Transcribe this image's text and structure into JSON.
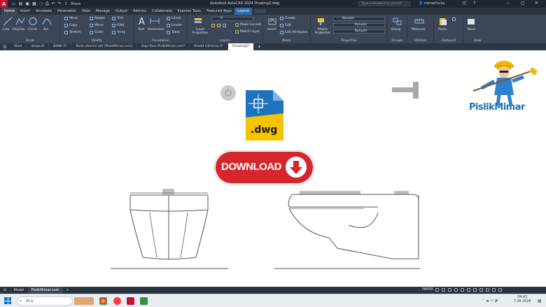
{
  "window": {
    "title": "Autodesk AutoCAD 2024    Drawing2.dwg",
    "search_placeholder": "Type a keyword or phrase",
    "user": "mimarfucky",
    "share_label": "Share",
    "logo_letter": "A"
  },
  "ribbon_tabs": [
    "Home",
    "Insert",
    "Annotate",
    "Parametric",
    "View",
    "Manage",
    "Output",
    "Add-ins",
    "Collaborate",
    "Express Tools",
    "Featured Apps",
    "Layout"
  ],
  "ribbon": {
    "draw": {
      "label": "Draw",
      "tools": [
        "Line",
        "Polyline",
        "Circle",
        "Arc"
      ]
    },
    "modify": {
      "label": "Modify",
      "tools": [
        "Move",
        "Rotate",
        "Trim",
        "Copy",
        "Mirror",
        "Fillet",
        "Stretch",
        "Scale",
        "Array"
      ]
    },
    "annotation": {
      "label": "Annotation",
      "tools": [
        "Text",
        "Dimension",
        "Linear",
        "Leader",
        "Table"
      ]
    },
    "layers": {
      "label": "Layers",
      "tools": [
        "Layer Properties",
        "Make Current",
        "Match Layer"
      ],
      "layer_value": "0"
    },
    "block": {
      "label": "Block",
      "tools": [
        "Insert",
        "Create",
        "Edit",
        "Edit Attributes"
      ]
    },
    "properties": {
      "label": "Properties",
      "tools": [
        "Match Properties"
      ],
      "values": [
        "ByLayer",
        "ByLayer",
        "ByLayer"
      ]
    },
    "groups": {
      "label": "Groups",
      "tools": [
        "Group"
      ]
    },
    "utilities": {
      "label": "Utilities",
      "tools": [
        "Measure"
      ]
    },
    "clipboard": {
      "label": "Clipboard",
      "tools": [
        "Paste"
      ]
    },
    "view": {
      "label": "View",
      "tools": [
        "Base"
      ]
    }
  },
  "doc_tabs": [
    "Start",
    "dorgindi",
    "BANK 2*",
    "Bank oturma ratı (PislikMimar.com)",
    "Kapı-Kolu-PislikMimar.com*",
    "Klozet Görünüş 0*",
    "Drawing2*"
  ],
  "active_doc_tab": "Drawing2*",
  "overlay": {
    "file_ext": ".dwg",
    "download_label": "DOWNLOAD",
    "brand": "PislikMimar",
    "colors": {
      "download_red": "#d7262b",
      "file_blue": "#1e73be",
      "file_yellow": "#f5c400",
      "brand_blue": "#1f6fb8"
    }
  },
  "status": {
    "layout_tabs": [
      "Model",
      "PislikMimar.com"
    ],
    "active_layout": "PislikMimar.com",
    "paper_label": "PAPER"
  },
  "taskbar": {
    "search_label": "Ara",
    "time": "04:43",
    "date": "7.05.2026"
  }
}
